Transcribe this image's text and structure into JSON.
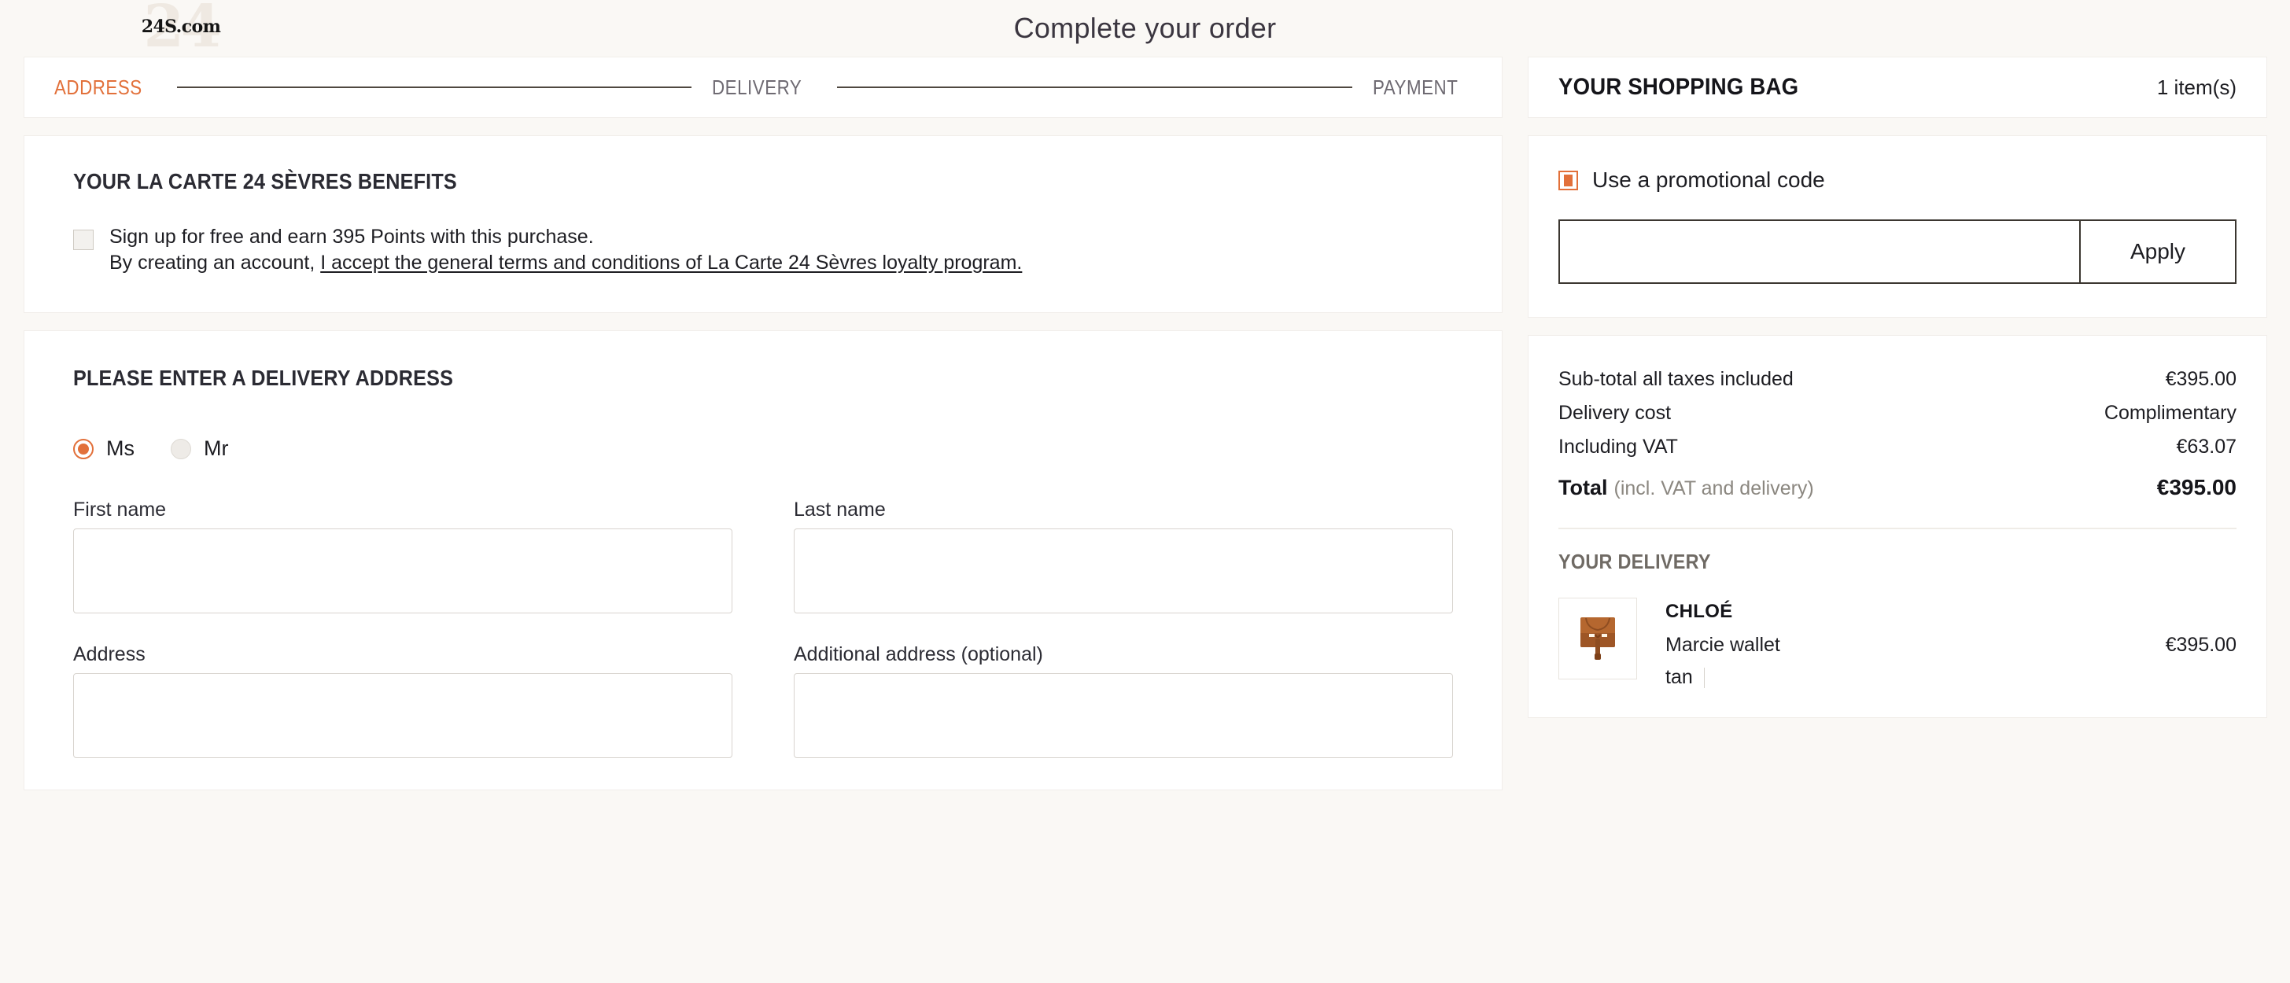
{
  "header": {
    "logo_text": "24S.com",
    "logo_watermark": "24",
    "title": "Complete your order"
  },
  "stepper": {
    "steps": [
      {
        "label": "ADDRESS",
        "state": "active"
      },
      {
        "label": "DELIVERY",
        "state": "idle"
      },
      {
        "label": "PAYMENT",
        "state": "idle"
      }
    ]
  },
  "benefits": {
    "heading": "YOUR LA CARTE 24 SÈVRES BENEFITS",
    "signup_text": "Sign up for free and earn 395 Points with this purchase.",
    "terms_prefix": "By creating an account, ",
    "terms_link": "I accept the general terms and conditions of La Carte 24 Sèvres loyalty program.",
    "checkbox_checked": false
  },
  "address": {
    "heading": "PLEASE ENTER A DELIVERY ADDRESS",
    "gender_options": [
      {
        "label": "Ms",
        "selected": true
      },
      {
        "label": "Mr",
        "selected": false
      }
    ],
    "fields": [
      {
        "label": "First name",
        "value": "",
        "placeholder": ""
      },
      {
        "label": "Last name",
        "value": "",
        "placeholder": ""
      },
      {
        "label": "Address",
        "value": "",
        "placeholder": ""
      },
      {
        "label": "Additional address (optional)",
        "value": "",
        "placeholder": ""
      }
    ]
  },
  "bag": {
    "title": "YOUR SHOPPING BAG",
    "count_label": "1  item(s)"
  },
  "promo": {
    "label": "Use a promotional code",
    "input_value": "",
    "input_placeholder": "",
    "apply_label": "Apply",
    "checkbox_checked": true
  },
  "summary": {
    "rows": [
      {
        "label": "Sub-total all taxes included",
        "value": "€395.00"
      },
      {
        "label": "Delivery cost",
        "value": "Complimentary"
      },
      {
        "label": "Including VAT",
        "value": "€63.07"
      }
    ],
    "total_label": "Total",
    "total_note": "(incl. VAT and delivery)",
    "total_value": "€395.00"
  },
  "delivery": {
    "heading": "YOUR DELIVERY",
    "item": {
      "brand": "CHLOÉ",
      "name": "Marcie wallet",
      "color": "tan",
      "size": "",
      "price": "€395.00"
    }
  },
  "colors": {
    "accent": "#e2703a",
    "page_bg": "#faf8f5",
    "card_bg": "#ffffff",
    "text": "#1d1d22",
    "muted": "#6f6a64",
    "product_leather": "#b5672f"
  }
}
